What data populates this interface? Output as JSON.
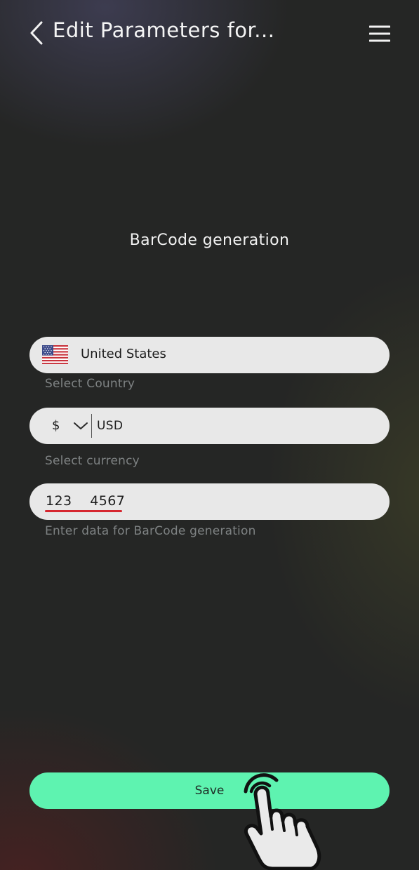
{
  "header": {
    "title": "Edit Parameters for...",
    "back_icon": "chevron-left-icon",
    "menu_icon": "hamburger-menu-icon"
  },
  "section": {
    "title": "BarCode generation"
  },
  "country_field": {
    "value": "United States",
    "helper": "Select Country",
    "flag_icon": "us-flag-icon"
  },
  "currency_field": {
    "symbol": "$",
    "code": "USD",
    "helper": "Select currency",
    "dropdown_icon": "chevron-down-icon"
  },
  "data_field": {
    "value": "123    4567",
    "helper": "Enter data for BarCode generation"
  },
  "save_button": {
    "label": "Save"
  },
  "colors": {
    "background": "#252625",
    "field_bg": "#e8e8e8",
    "accent": "#5ef3b0",
    "helper_text": "#7e8283",
    "spellcheck": "#d6262f"
  }
}
